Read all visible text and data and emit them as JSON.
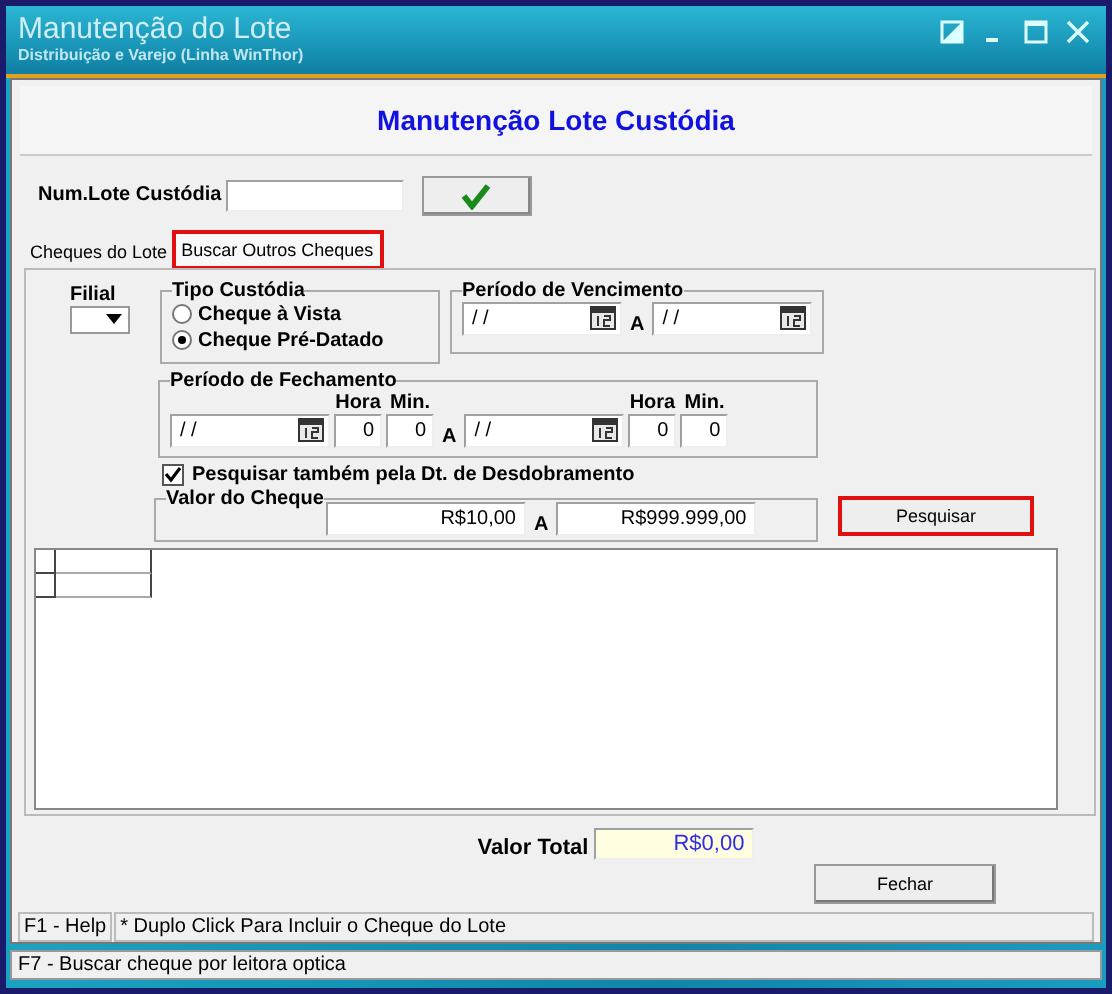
{
  "window": {
    "title": "Manutenção do Lote",
    "subtitle": "Distribuição e Varejo (Linha WinThor)"
  },
  "heading": "Manutenção Lote Custódia",
  "lote": {
    "label": "Num.Lote Custódia"
  },
  "tabs": [
    {
      "label": "Cheques do Lote",
      "selected": false,
      "highlighted": false
    },
    {
      "label": "Buscar Outros Cheques",
      "selected": true,
      "highlighted": true
    }
  ],
  "filial": {
    "label": "Filial"
  },
  "tipo_custodia": {
    "title": "Tipo Custódia",
    "options": [
      {
        "label": "Cheque à Vista",
        "selected": false
      },
      {
        "label": "Cheque Pré-Datado",
        "selected": true
      }
    ]
  },
  "periodo_vencimento": {
    "title": "Período de Vencimento",
    "from": "/ /",
    "separator": "A",
    "to": "/ /"
  },
  "periodo_fechamento": {
    "title": "Período de Fechamento",
    "separator": "A",
    "ranges": [
      {
        "date": "/ /",
        "hour_label": "Hora",
        "hour": "0",
        "min_label": "Min.",
        "min": "0"
      },
      {
        "date": "/ /",
        "hour_label": "Hora",
        "hour": "0",
        "min_label": "Min.",
        "min": "0"
      }
    ]
  },
  "desdobramento": {
    "label": "Pesquisar também pela Dt. de Desdobramento",
    "checked": true
  },
  "valor_cheque": {
    "title": "Valor do Cheque",
    "from": "R$10,00",
    "separator": "A",
    "to": "R$999.999,00"
  },
  "search_button": {
    "label": "Pesquisar",
    "highlighted": true
  },
  "total": {
    "label": "Valor Total",
    "value": "R$0,00"
  },
  "close_button": {
    "label": "Fechar"
  },
  "status_panels": [
    "F1 - Help",
    "* Duplo Click Para Incluir o Cheque do Lote"
  ],
  "status_bar": "F7 - Buscar cheque por leitora optica"
}
